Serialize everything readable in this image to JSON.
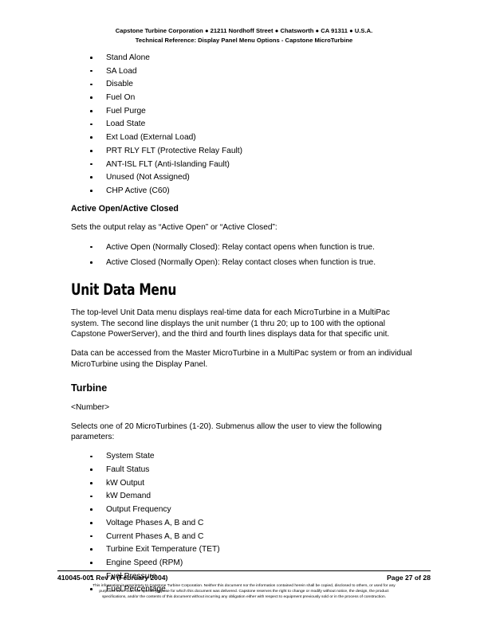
{
  "header": {
    "line1": "Capstone Turbine Corporation ● 21211 Nordhoff Street ● Chatsworth ● CA 91311 ● U.S.A.",
    "line2": "Technical Reference: Display Panel Menu Options - Capstone MicroTurbine"
  },
  "content": {
    "relay_options": [
      "Stand Alone",
      "SA Load",
      "Disable",
      "Fuel On",
      "Fuel Purge",
      "Load State",
      "Ext Load (External Load)",
      "PRT RLY FLT (Protective Relay Fault)",
      "ANT-ISL FLT (Anti-Islanding Fault)",
      "Unused (Not Assigned)",
      "CHP Active (C60)"
    ],
    "active_open_closed": {
      "heading": "Active Open/Active Closed",
      "intro": "Sets the output relay as “Active Open” or “Active Closed”:",
      "items": [
        "Active Open (Normally Closed): Relay contact opens when function is true.",
        "Active Closed (Normally Open): Relay contact closes when function is true."
      ]
    },
    "unit_data_menu": {
      "heading": "Unit Data Menu",
      "paragraph1": "The top-level Unit Data menu displays real-time data for each MicroTurbine in a MultiPac system. The second line displays the unit number (1 thru 20; up to 100 with the optional Capstone PowerServer), and the third and fourth lines displays data for that specific unit.",
      "paragraph2": "Data can be accessed from the Master MicroTurbine in a MultiPac system or from an individual MicroTurbine using the Display Panel."
    },
    "turbine": {
      "heading": "Turbine",
      "number_label": "<Number>",
      "paragraph": "Selects one of 20 MicroTurbines (1-20). Submenus allow the user to view the following parameters:",
      "parameters": [
        "System State",
        "Fault Status",
        "kW Output",
        "kW Demand",
        "Output Frequency",
        "Voltage Phases A, B and C",
        "Current Phases A, B and C",
        "Turbine Exit Temperature (TET)",
        "Engine Speed (RPM)",
        "Fuel Pressure",
        "Fuel Percentage"
      ]
    }
  },
  "footer": {
    "doc_id": "410045-001 Rev A (February 2004)",
    "page_number": "Page 27 of 28",
    "legal_line1": "This information is proprietary to Capstone Turbine Corporation. Neither this document nor the information contained herein shall be copied, disclosed to others, or used for any",
    "legal_line2": "purposes other than the specific purpose for which this document was delivered. Capstone reserves the right to change or modify without notice, the design, the product",
    "legal_line3": "specifications, and/or the contents of this document without incurring any obligation either with respect to equipment previously sold or in the process of construction."
  }
}
